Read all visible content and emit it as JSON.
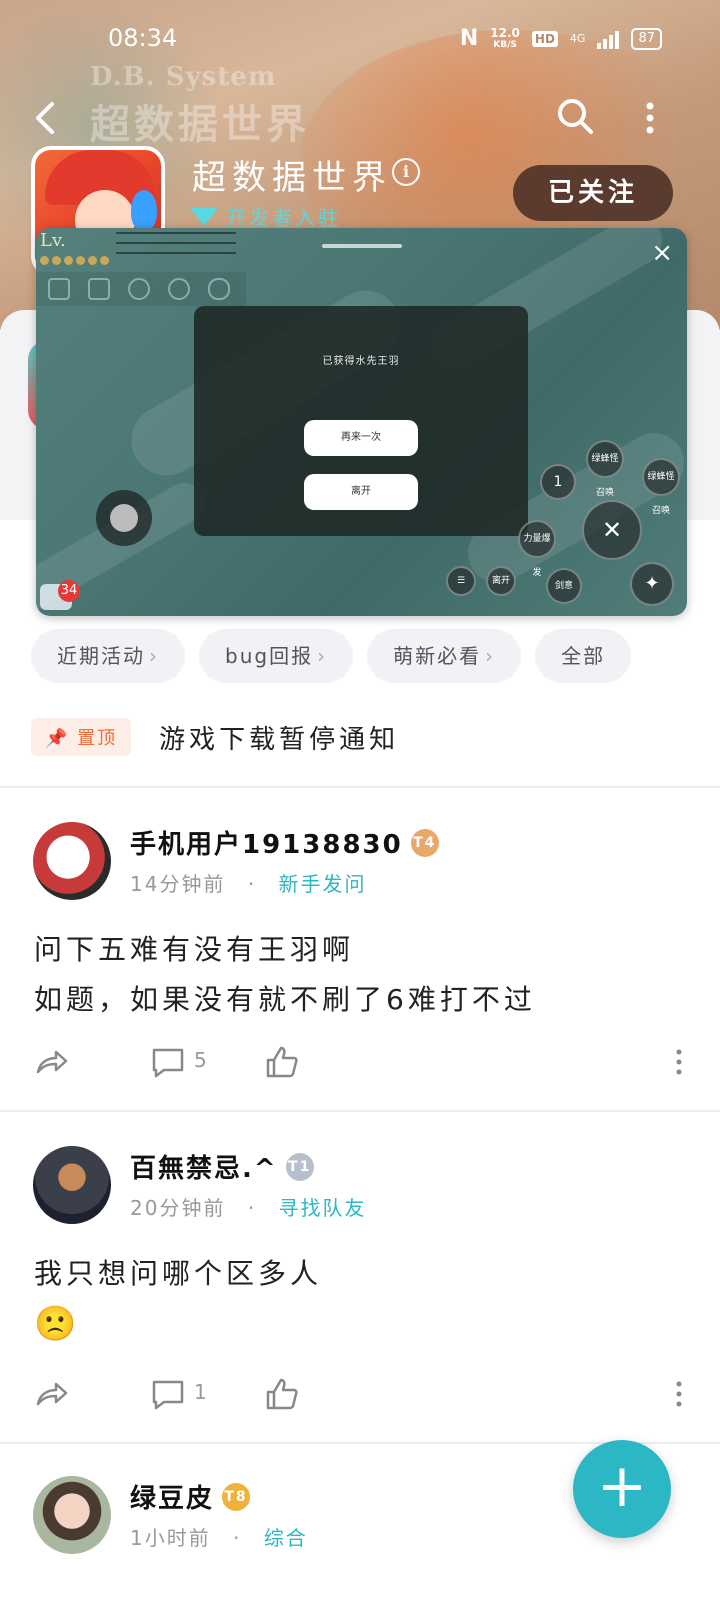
{
  "status_bar": {
    "time": "08:34",
    "net_speed_value": "12.0",
    "net_speed_unit": "KB/S",
    "hd": "HD",
    "network": "4G",
    "battery": "87"
  },
  "header": {
    "banner_logo": "D.B. System",
    "banner_logo_cn": "超数据世界",
    "app_title": "超数据世界",
    "info_icon": "i",
    "dev_badge": "开发者入驻",
    "follow_label": "已关注"
  },
  "game_overlay": {
    "close": "×",
    "level_label": "Lv.",
    "dialog_message": "已获得水先王羽",
    "retry_button": "再来一次",
    "leave_button": "离开",
    "skill_1": "1",
    "skill_summon_1": "绿蜂怪召唤",
    "skill_summon_2": "绿蜂怪召唤",
    "skill_power": "力量爆发",
    "skill_leave": "离开",
    "skill_sword": "剑意",
    "chat_badge": "34"
  },
  "chips": [
    {
      "label": "近期活动",
      "chevron": "›"
    },
    {
      "label": "bug回报",
      "chevron": "›"
    },
    {
      "label": "萌新必看",
      "chevron": "›"
    },
    {
      "label": "全部",
      "chevron": ""
    }
  ],
  "pinned": {
    "tag": "置顶",
    "title": "游戏下载暂停通知"
  },
  "posts": [
    {
      "author": "手机用户19138830",
      "level": "T4",
      "time": "14分钟前",
      "dot": "·",
      "category": "新手发问",
      "lines": [
        "问下五难有没有王羽啊",
        "如题，如果没有就不刷了6难打不过"
      ],
      "comments": "5",
      "level_color": "#e8a86a"
    },
    {
      "author": "百無禁忌.^",
      "level": "T1",
      "time": "20分钟前",
      "dot": "·",
      "category": "寻找队友",
      "lines": [
        "我只想问哪个区多人",
        "🙁"
      ],
      "comments": "1",
      "level_color": "#b8bfcc"
    },
    {
      "author": "绿豆皮",
      "level": "T8",
      "time": "1小时前",
      "dot": "·",
      "category": "综合",
      "level_color": "#f0b23a"
    }
  ],
  "fab_label": "+",
  "colors": {
    "accent": "#2bb7c4",
    "pin": "#f26b3a"
  }
}
